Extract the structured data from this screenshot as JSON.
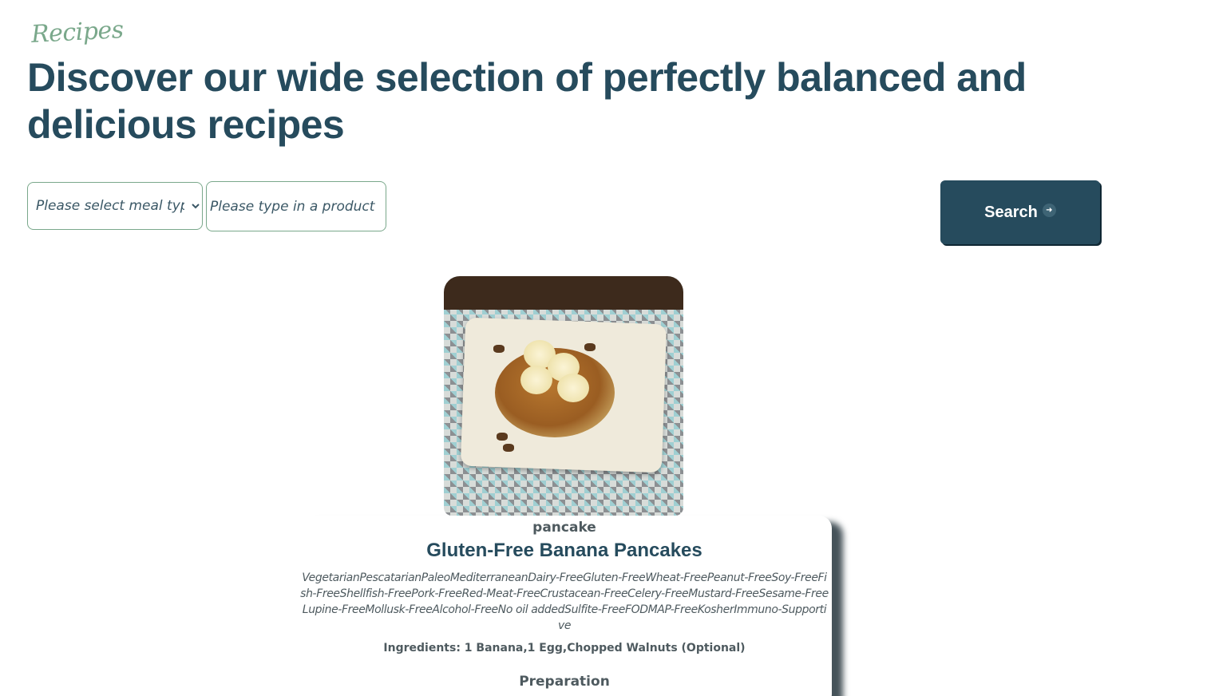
{
  "header": {
    "eyebrow": "Recipes",
    "headline": "Discover our wide selection of perfectly balanced and delicious recipes"
  },
  "filters": {
    "meal_type_placeholder": "Please select meal type",
    "product_placeholder": "Please type in a product",
    "search_label": "Search",
    "search_icon": "arrow-right-circle-icon"
  },
  "recipe": {
    "image_alt": "Gluten-Free Banana Pancakes",
    "category": "pancake",
    "title": "Gluten-Free Banana Pancakes",
    "tags": "VegetarianPescatarianPaleoMediterraneanDairy-FreeGluten-FreeWheat-FreePeanut-FreeSoy-FreeFish-FreeShellfish-FreePork-FreeRed-Meat-FreeCrustacean-FreeCelery-FreeMustard-FreeSesame-FreeLupine-FreeMollusk-FreeAlcohol-FreeNo oil addedSulfite-FreeFODMAP-FreeKosherImmuno-Supportive",
    "ingredients": "Ingredients: 1 Banana,1 Egg,Chopped Walnuts (Optional)",
    "preparation_heading": "Preparation"
  },
  "colors": {
    "primary": "#264b5d",
    "accent": "#7aa88b",
    "text_muted": "#4e5a5f"
  }
}
